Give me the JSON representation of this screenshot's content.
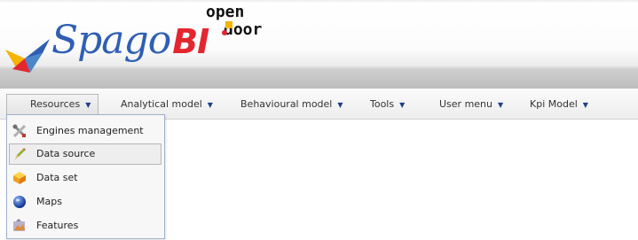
{
  "header": {
    "logo_main": "Spago",
    "logo_accent": "BI",
    "opendoor_logo_text": "open door"
  },
  "menu": {
    "items": [
      {
        "label": "Resources",
        "arrow": "▼"
      },
      {
        "label": "Analytical model",
        "arrow": "▼"
      },
      {
        "label": "Behavioural model",
        "arrow": "▼"
      },
      {
        "label": "Tools",
        "arrow": "▼"
      },
      {
        "label": "User menu",
        "arrow": "▼"
      },
      {
        "label": "Kpi Model",
        "arrow": "▼"
      }
    ]
  },
  "dropdown": {
    "items": [
      {
        "label": "Engines management",
        "icon": "tools-icon"
      },
      {
        "label": "Data source",
        "icon": "pencil-icon"
      },
      {
        "label": "Data set",
        "icon": "cube-icon"
      },
      {
        "label": "Maps",
        "icon": "globe-icon"
      },
      {
        "label": "Features",
        "icon": "features-icon"
      }
    ],
    "highlighted_index": 1
  },
  "colors": {
    "brand_blue": "#2f5fb4",
    "brand_red": "#e3262f",
    "menu_arrow": "#1f3d8a"
  }
}
